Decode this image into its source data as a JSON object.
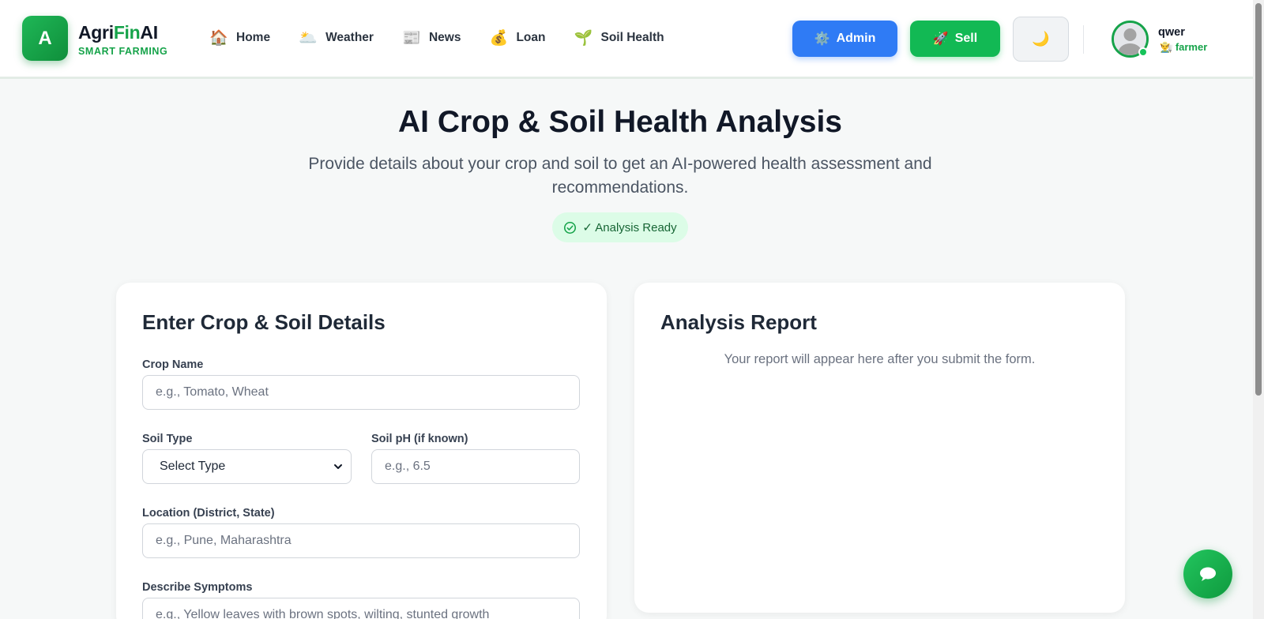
{
  "brand": {
    "logo_letter": "A",
    "name_prefix": "Agri",
    "name_accent": "Fin",
    "name_suffix": "AI",
    "tagline": "SMART FARMING",
    "accent_color": "#16a34a"
  },
  "nav": {
    "items": [
      {
        "label": "Home",
        "icon": "house-icon",
        "glyph": "🏠"
      },
      {
        "label": "Weather",
        "icon": "weather-icon",
        "glyph": "🌥️"
      },
      {
        "label": "News",
        "icon": "newspaper-icon",
        "glyph": "📰"
      },
      {
        "label": "Loan",
        "icon": "money-bag-icon",
        "glyph": "💰"
      },
      {
        "label": "Soil Health",
        "icon": "seedling-icon",
        "glyph": "🌱"
      }
    ]
  },
  "actions": {
    "admin_label": "Admin",
    "admin_glyph": "⚙️",
    "sell_label": "Sell",
    "sell_glyph": "🚀",
    "theme_glyph": "🌙"
  },
  "user": {
    "name": "qwer",
    "role_glyph": "👨‍🌾",
    "role": "farmer"
  },
  "hero": {
    "title": "AI Crop & Soil Health Analysis",
    "subtitle": "Provide details about your crop and soil to get an AI-powered health assessment and recommendations.",
    "status": "✓ Analysis Ready"
  },
  "form": {
    "title": "Enter Crop & Soil Details",
    "crop_name_label": "Crop Name",
    "crop_name_placeholder": "e.g., Tomato, Wheat",
    "soil_type_label": "Soil Type",
    "soil_type_value": "Select Type",
    "soil_ph_label": "Soil pH (if known)",
    "soil_ph_placeholder": "e.g., 6.5",
    "location_label": "Location (District, State)",
    "location_placeholder": "e.g., Pune, Maharashtra",
    "symptoms_label": "Describe Symptoms",
    "symptoms_placeholder": "e.g., Yellow leaves with brown spots, wilting, stunted growth"
  },
  "report": {
    "title": "Analysis Report",
    "empty_text": "Your report will appear here after you submit the form."
  }
}
